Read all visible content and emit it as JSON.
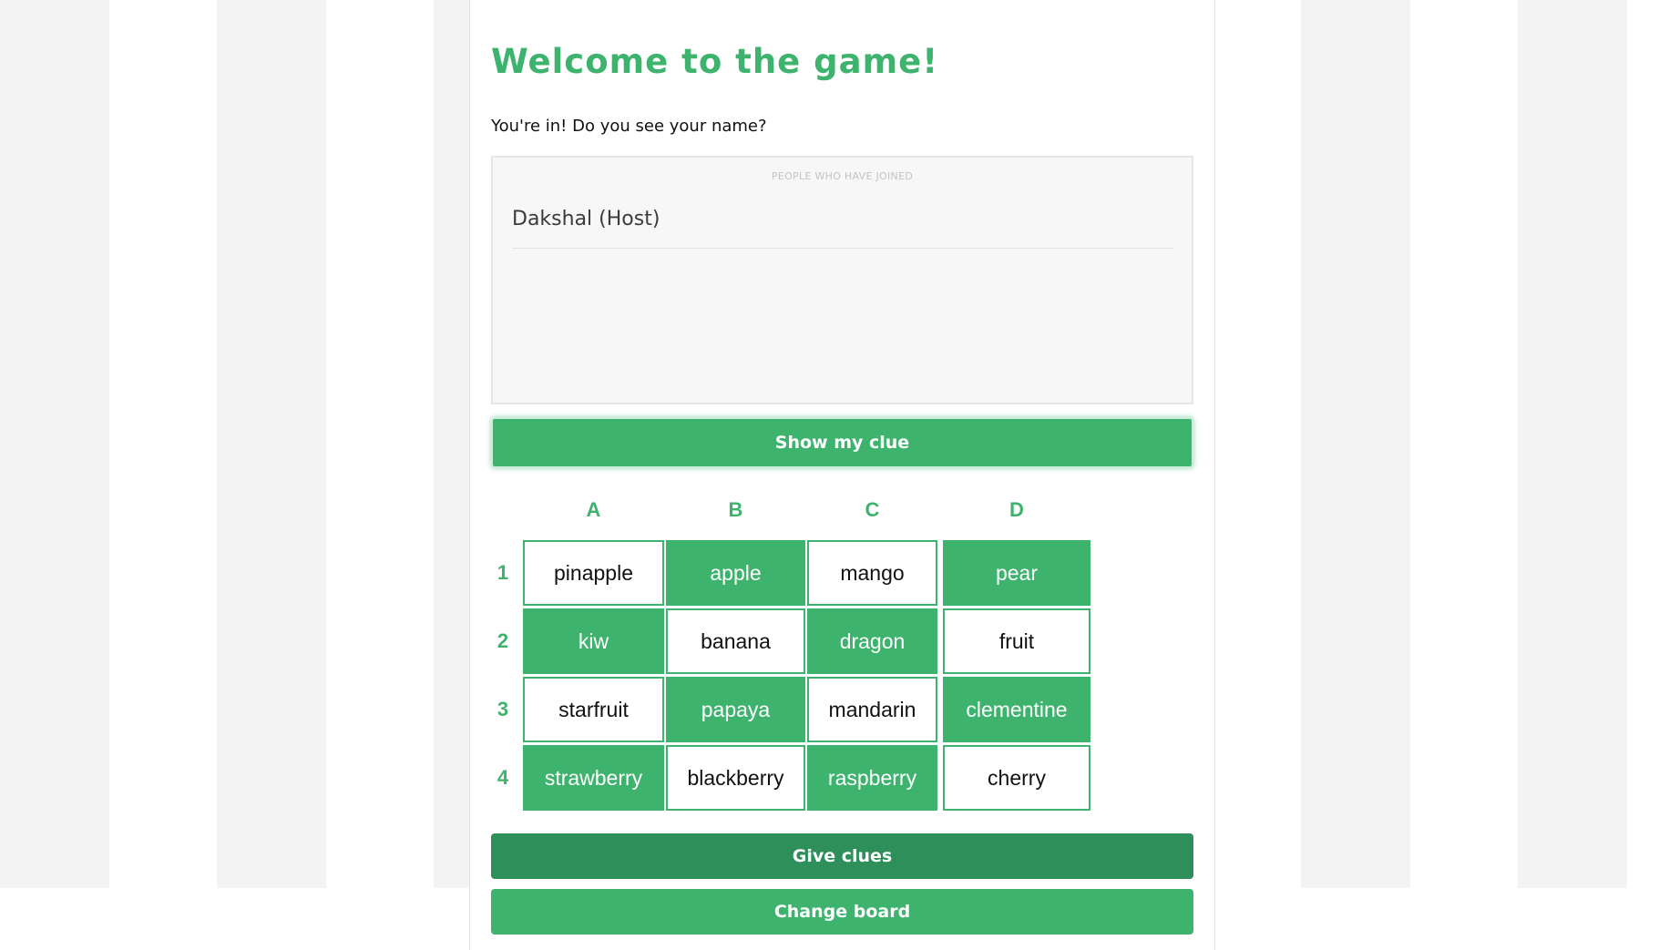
{
  "header": {
    "title": "Welcome to the game!",
    "subtitle": "You're in! Do you see your name?"
  },
  "joined": {
    "caption": "PEOPLE WHO HAVE JOINED",
    "players": [
      "Dakshal (Host)"
    ]
  },
  "buttons": {
    "show_clue": "Show my clue",
    "give_clues": "Give clues",
    "change_board": "Change board"
  },
  "board": {
    "columns": [
      "A",
      "B",
      "C",
      "D"
    ],
    "rows": [
      "1",
      "2",
      "3",
      "4"
    ],
    "cells": [
      [
        {
          "word": "pinapple",
          "filled": false
        },
        {
          "word": "apple",
          "filled": true
        },
        {
          "word": "mango",
          "filled": false
        },
        {
          "word": "pear",
          "filled": true
        }
      ],
      [
        {
          "word": "kiw",
          "filled": true
        },
        {
          "word": "banana",
          "filled": false
        },
        {
          "word": "dragon",
          "filled": true
        },
        {
          "word": "fruit",
          "filled": false
        }
      ],
      [
        {
          "word": "starfruit",
          "filled": false
        },
        {
          "word": "papaya",
          "filled": true
        },
        {
          "word": "mandarin",
          "filled": false
        },
        {
          "word": "clementine",
          "filled": true
        }
      ],
      [
        {
          "word": "strawberry",
          "filled": true
        },
        {
          "word": "blackberry",
          "filled": false
        },
        {
          "word": "raspberry",
          "filled": true
        },
        {
          "word": "cherry",
          "filled": false
        }
      ]
    ]
  },
  "colors": {
    "accent": "#3db36d",
    "accent_dark": "#2e8f5a",
    "stripe": "#f3f3f3"
  }
}
